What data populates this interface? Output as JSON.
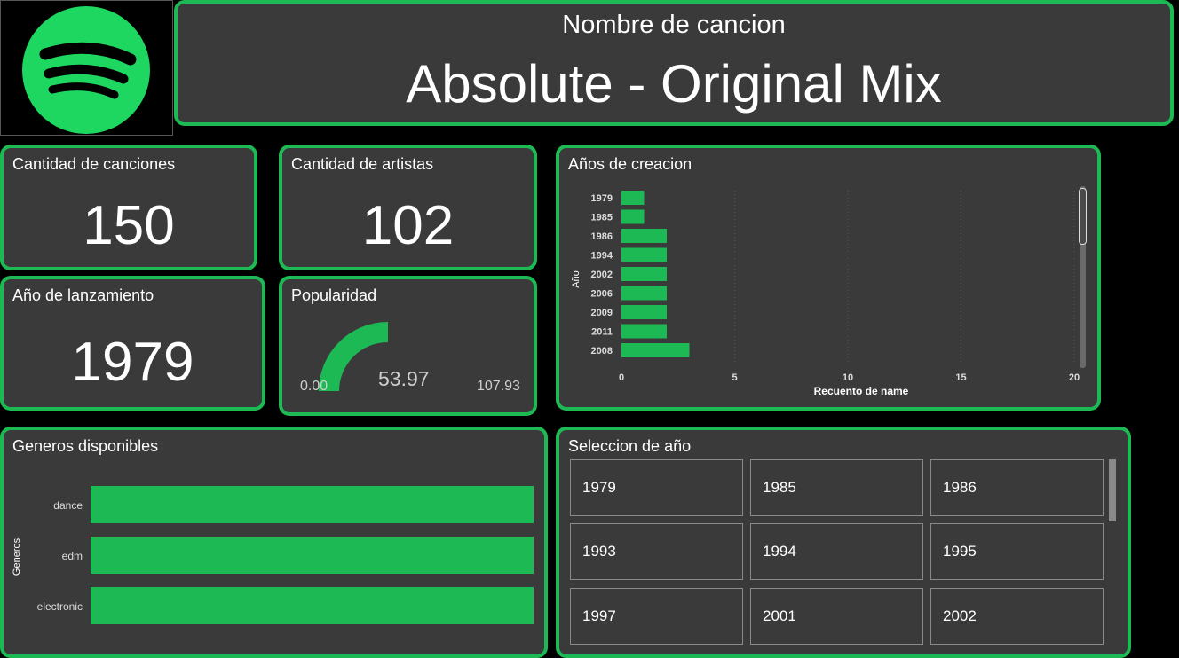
{
  "colors": {
    "accent": "#1db954",
    "card_bg": "#3a3a3a",
    "page_bg": "#000000"
  },
  "logo": {
    "icon": "spotify-logo"
  },
  "header": {
    "subtitle": "Nombre de cancion",
    "title": "Absolute - Original Mix"
  },
  "kpis": {
    "canciones": {
      "label": "Cantidad de canciones",
      "value": "150"
    },
    "artistas": {
      "label": "Cantidad de artistas",
      "value": "102"
    },
    "anio": {
      "label": "Año de lanzamiento",
      "value": "1979"
    }
  },
  "popularidad": {
    "label": "Popularidad",
    "min": "0.00",
    "value_label": "53.97",
    "max": "107.93",
    "value": 53.97,
    "max_value": 107.93
  },
  "chart_anios_title": "Años de creacion",
  "chart_generos_title": "Generos disponibles",
  "slicer": {
    "title": "Seleccion de año",
    "items": [
      "1979",
      "1985",
      "1986",
      "1993",
      "1994",
      "1995",
      "1997",
      "2001",
      "2002"
    ]
  },
  "chart_data": [
    {
      "type": "bar",
      "orientation": "horizontal",
      "title": "Años de creacion",
      "xlabel": "Recuento de name",
      "ylabel": "Año",
      "categories": [
        "1979",
        "1985",
        "1986",
        "1994",
        "2002",
        "2006",
        "2009",
        "2011",
        "2008"
      ],
      "values": [
        1,
        1,
        2,
        2,
        2,
        2,
        2,
        2,
        3
      ],
      "xlim": [
        0,
        20
      ],
      "xticks": [
        "0",
        "5",
        "10",
        "15",
        "20"
      ],
      "grid": true
    },
    {
      "type": "bar",
      "orientation": "horizontal",
      "title": "Generos disponibles",
      "xlabel": "",
      "ylabel": "Generos",
      "categories": [
        "dance",
        "edm",
        "electronic"
      ],
      "values": [
        1,
        1,
        1
      ],
      "xlim": [
        0,
        1
      ],
      "grid": false
    }
  ]
}
